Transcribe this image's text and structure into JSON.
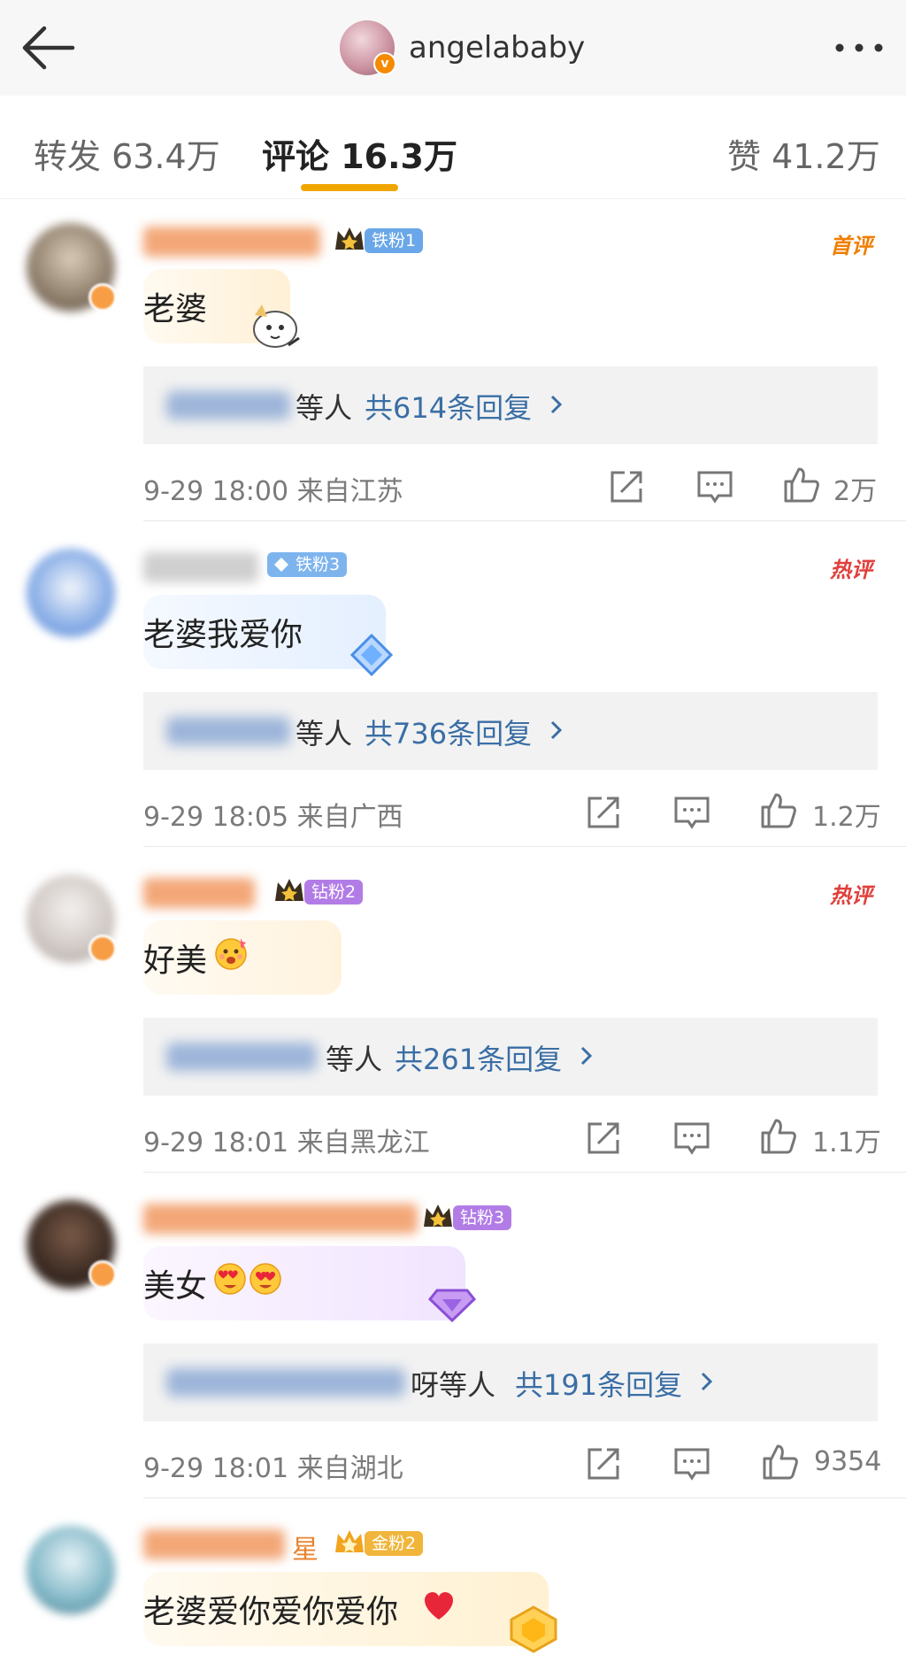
{
  "header": {
    "title": "angelababy",
    "back_icon": "arrow-left-icon",
    "more_icon": "more-dots-icon"
  },
  "tabs": [
    {
      "label": "转发 63.4万"
    },
    {
      "label": "评论 16.3万",
      "active": true
    },
    {
      "label": "赞 41.2万"
    }
  ],
  "colors": {
    "accent": "#f0a500",
    "link": "#3a6ea5",
    "first_tag": "#f07e00",
    "hot_tag": "#e0403c"
  },
  "comments": [
    {
      "badge": "铁粉1",
      "tag": "首评",
      "text": "老婆",
      "reply_suffix": "等人",
      "reply_count": "共614条回复",
      "meta": "9-29 18:00 来自江苏",
      "likes": "2万"
    },
    {
      "badge": "铁粉3",
      "tag": "热评",
      "text": "老婆我爱你",
      "reply_suffix": "等人",
      "reply_count": "共736条回复",
      "meta": "9-29 18:05 来自广西",
      "likes": "1.2万"
    },
    {
      "badge": "钻粉2",
      "tag": "热评",
      "text": "好美",
      "reply_suffix": "等人",
      "reply_count": "共261条回复",
      "meta": "9-29 18:01 来自黑龙江",
      "likes": "1.1万"
    },
    {
      "badge": "钻粉3",
      "tag": "",
      "text": "美女",
      "reply_suffix": "呀等人",
      "reply_count": "共191条回复",
      "meta": "9-29 18:01 来自湖北",
      "likes": "9354"
    },
    {
      "badge": "金粉2",
      "tag": "",
      "username_visible_suffix": "星",
      "text": "老婆爱你爱你爱你"
    }
  ]
}
